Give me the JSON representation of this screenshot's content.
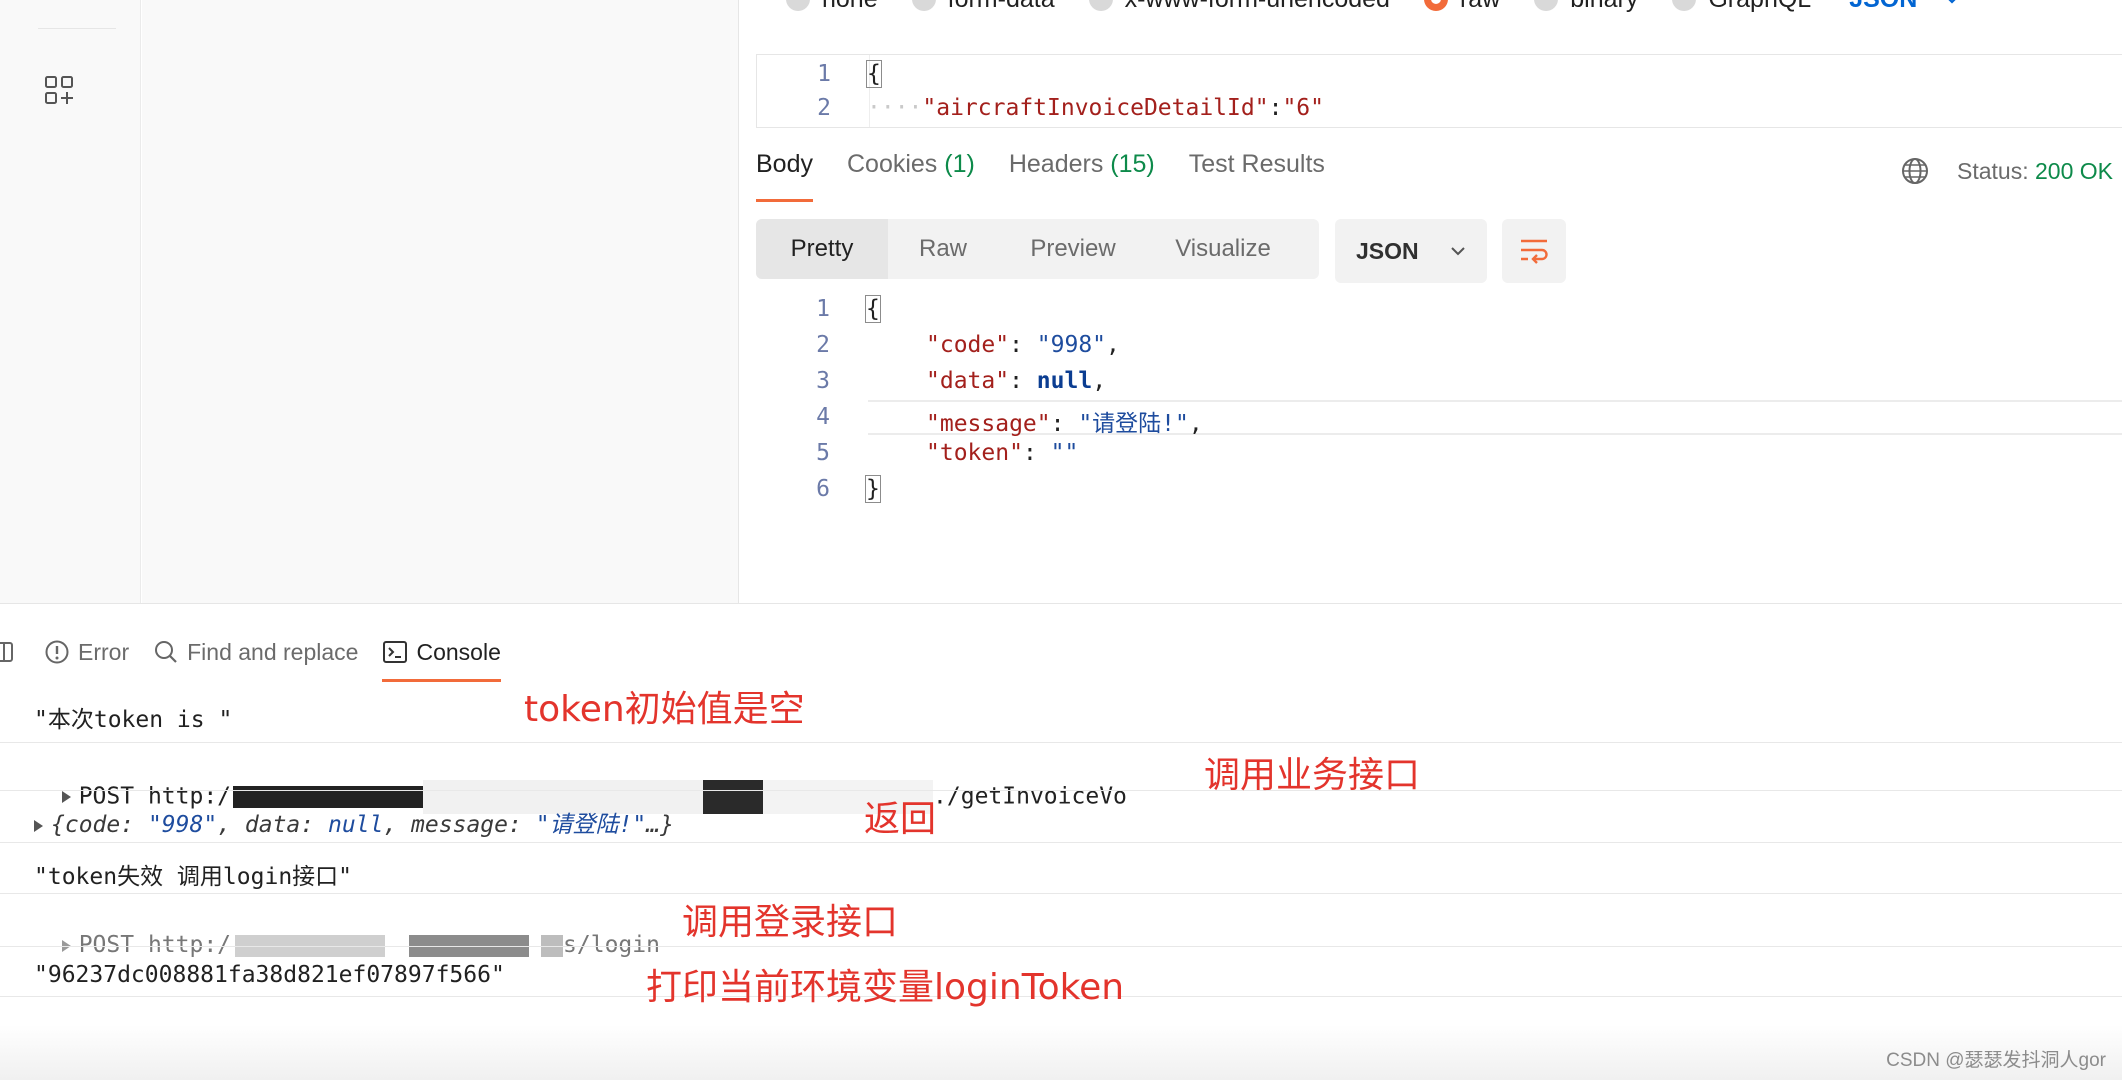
{
  "request_body_types": {
    "options": [
      "none",
      "form-data",
      "x-www-form-urlencoded",
      "raw",
      "binary",
      "GraphQL"
    ],
    "selected": "raw",
    "format": "JSON"
  },
  "request_editor": {
    "lines": [
      "1",
      "2"
    ],
    "brace": "{",
    "key": "\"aircraftInvoiceDetailId\"",
    "colon": ":",
    "value": "\"6\""
  },
  "response": {
    "tabs": [
      {
        "label": "Body",
        "count": ""
      },
      {
        "label": "Cookies",
        "count": "(1)"
      },
      {
        "label": "Headers",
        "count": "(15)"
      },
      {
        "label": "Test Results",
        "count": ""
      }
    ],
    "status_label": "Status:",
    "status_value": "200 OK",
    "views": [
      "Pretty",
      "Raw",
      "Preview",
      "Visualize"
    ],
    "format": "JSON",
    "line_numbers": [
      "1",
      "2",
      "3",
      "4",
      "5",
      "6"
    ],
    "code": {
      "open": "{",
      "code_key": "\"code\"",
      "code_val": "\"998\"",
      "data_key": "\"data\"",
      "data_val": "null",
      "message_key": "\"message\"",
      "message_val": "\"请登陆!\"",
      "token_key": "\"token\"",
      "token_val": "\"\"",
      "close": "}"
    }
  },
  "bottom_bar": {
    "error": "Error",
    "find_replace": "Find and replace",
    "console": "Console"
  },
  "console": {
    "log1": "\"本次token is \"",
    "post1_method": "POST http:/",
    "post1_path": "./getInvoiceVo",
    "obj_prefix": "{code: ",
    "obj_code": "\"998\"",
    "obj_mid1": ", data: ",
    "obj_data": "null",
    "obj_mid2": ", message: ",
    "obj_msg": "\"请登陆!\"",
    "obj_suffix": "…}",
    "log2": "\"token失效 调用login接口\"",
    "post2_method": "POST http:/",
    "post2_path": "s/login",
    "log3": "\"96237dc008881fa38d821ef07897f566\""
  },
  "annotations": {
    "a1": "token初始值是空",
    "a2": "调用业务接口",
    "a3": "返回",
    "a4": "调用登录接口",
    "a5": "打印当前环境变量loginToken"
  },
  "watermark": "CSDN @瑟瑟发抖洞人gor",
  "colors": {
    "accent": "#f26b3a",
    "annotation": "#e3342c",
    "status_ok": "#0d8a4a",
    "json_key": "#a3201c",
    "json_string": "#1e4c9e"
  }
}
